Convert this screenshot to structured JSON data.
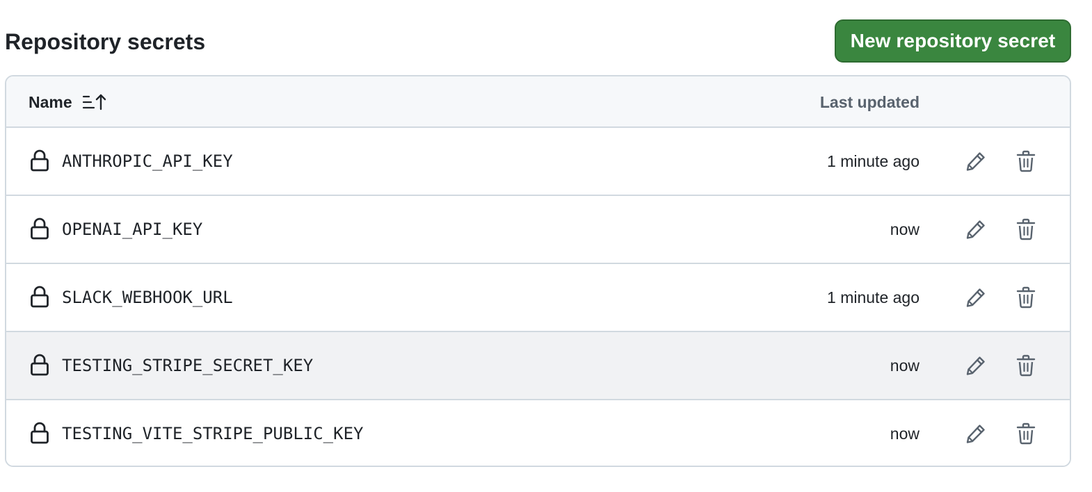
{
  "header": {
    "title": "Repository secrets",
    "new_button_label": "New repository secret"
  },
  "colors": {
    "primary_button": "#3a863f",
    "border": "#d1d9e0",
    "header_bg": "#f6f8fa",
    "hover_row_bg": "#f1f2f4"
  },
  "table": {
    "columns": {
      "name": "Name",
      "last_updated": "Last updated"
    },
    "sort_icon": "sort-ascending-icon",
    "rows": [
      {
        "name": "ANTHROPIC_API_KEY",
        "updated": "1 minute ago"
      },
      {
        "name": "OPENAI_API_KEY",
        "updated": "now"
      },
      {
        "name": "SLACK_WEBHOOK_URL",
        "updated": "1 minute ago"
      },
      {
        "name": "TESTING_STRIPE_SECRET_KEY",
        "updated": "now"
      },
      {
        "name": "TESTING_VITE_STRIPE_PUBLIC_KEY",
        "updated": "now"
      }
    ],
    "row_icons": [
      "lock-icon",
      "pencil-icon",
      "trash-icon"
    ]
  }
}
